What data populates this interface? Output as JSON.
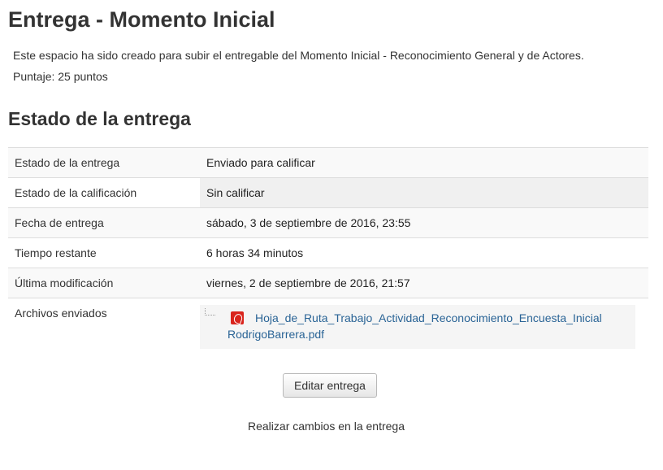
{
  "page": {
    "title": "Entrega - Momento Inicial",
    "description": "Este espacio ha sido creado para subir el entregable del Momento Inicial - Reconocimiento General y de Actores.",
    "score": "Puntaje: 25 puntos"
  },
  "submission_status": {
    "heading": "Estado de la entrega",
    "rows": [
      {
        "label": "Estado de la entrega",
        "value": "Enviado para calificar"
      },
      {
        "label": "Estado de la calificación",
        "value": "Sin calificar"
      },
      {
        "label": "Fecha de entrega",
        "value": "sábado, 3 de septiembre de 2016, 23:55"
      },
      {
        "label": "Tiempo restante",
        "value": "6 horas 34 minutos"
      },
      {
        "label": "Última modificación",
        "value": "viernes, 2 de septiembre de 2016, 21:57"
      },
      {
        "label": "Archivos enviados",
        "value": ""
      }
    ],
    "file": {
      "name_line1": "Hoja_de_Ruta_Trabajo_Actividad_Reconocimiento_Encuesta_Inicial",
      "name_line2": "RodrigoBarrera.pdf",
      "icon": "pdf-icon",
      "icon_color": "#d9241c"
    }
  },
  "actions": {
    "edit_label": "Editar entrega",
    "edit_help": "Realizar cambios en la entrega"
  },
  "colors": {
    "link": "#2a6496",
    "text": "#333333"
  }
}
